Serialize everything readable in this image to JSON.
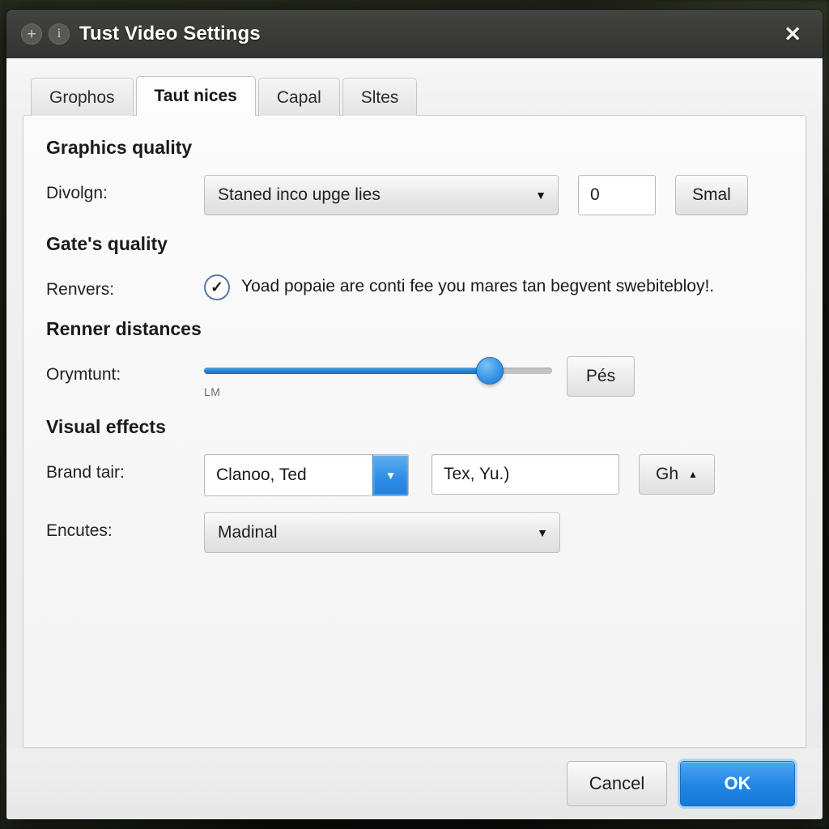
{
  "window": {
    "title": "Tust Video Settings",
    "icons": {
      "settings": "+",
      "info": "i"
    },
    "close_label": "✕"
  },
  "tabs": [
    {
      "label": "Grophos",
      "active": false
    },
    {
      "label": "Taut nices",
      "active": true
    },
    {
      "label": "Capal",
      "active": false
    },
    {
      "label": "Sltes",
      "active": false
    }
  ],
  "sections": {
    "graphics_quality": {
      "title": "Graphics quality",
      "row_label": "Divolgn:",
      "dropdown_value": "Staned inco upge lies",
      "number_value": "0",
      "button_label": "Smal",
      "caret": "▼"
    },
    "gates_quality": {
      "title": "Gate's quality",
      "row_label": "Renvers:",
      "checkbox_checked": true,
      "checkbox_mark": "✓",
      "checkbox_text": "Yoad popaie are conti fee you mares tan begvent swebitebloy!."
    },
    "renner_distances": {
      "title": "Renner distances",
      "row_label": "Orymtunt:",
      "slider_percent": 82,
      "slider_min_label": "LM",
      "button_label": "Pés"
    },
    "visual_effects": {
      "title": "Visual effects",
      "row_label": "Brand tair:",
      "combo_value": "Clanoo, Ted",
      "combo_caret": "▼",
      "text_value": "Tex, Yu.)",
      "button_label": "Gh",
      "button_caret": "▲",
      "row2_label": "Encutes:",
      "dropdown2_value": "Madinal",
      "dropdown2_caret": "▼"
    }
  },
  "footer": {
    "cancel_label": "Cancel",
    "ok_label": "OK"
  },
  "colors": {
    "accent_blue": "#1f86e4",
    "titlebar": "#3a3a37",
    "panel": "#fbfbfb",
    "slider_fill": "#1f7fd4"
  }
}
